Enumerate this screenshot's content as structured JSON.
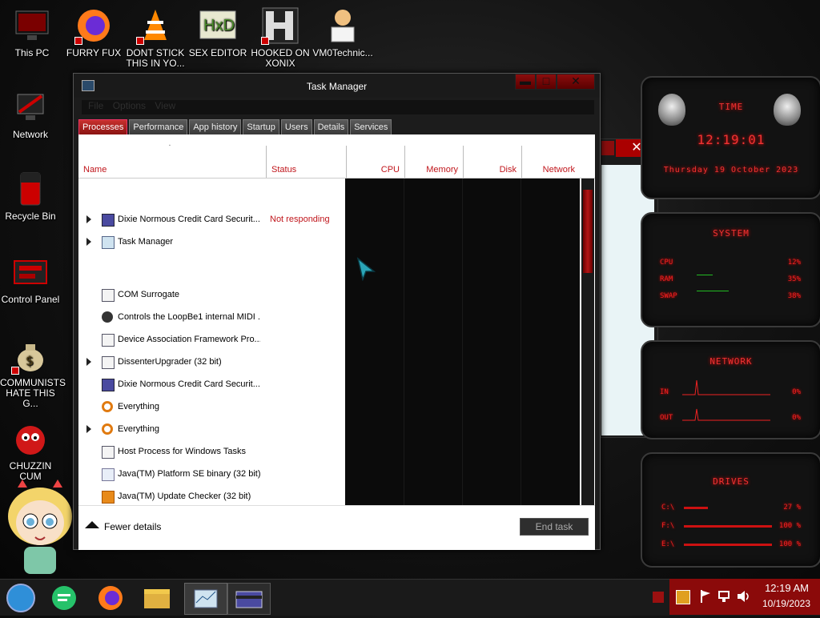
{
  "desktop_icons": [
    {
      "label": "This PC"
    },
    {
      "label": "FURRY FUX"
    },
    {
      "label": "DONT STICK THIS IN YO..."
    },
    {
      "label": "SEX EDITOR"
    },
    {
      "label": "HOOKED ON XONIX"
    },
    {
      "label": "VM0Technic..."
    },
    {
      "label": "Network"
    },
    {
      "label": "Recycle Bin"
    },
    {
      "label": "Control Panel"
    },
    {
      "label": "COMMUNISTS HATE THIS G..."
    },
    {
      "label": "CHUZZIN CUM"
    }
  ],
  "task_manager": {
    "title": "Task Manager",
    "menu": [
      "File",
      "Options",
      "View"
    ],
    "tabs": [
      "Processes",
      "Performance",
      "App history",
      "Startup",
      "Users",
      "Details",
      "Services"
    ],
    "active_tab": "Processes",
    "columns": {
      "name": "Name",
      "status": "Status",
      "cpu": "CPU",
      "memory": "Memory",
      "disk": "Disk",
      "network": "Network"
    },
    "rows": [
      {
        "name": "Dixie Normous Credit Card Securit...",
        "status": "Not responding",
        "expandable": true,
        "icon": "card-app-icon"
      },
      {
        "name": "Task Manager",
        "status": "",
        "expandable": true,
        "icon": "task-manager-icon"
      },
      {
        "name": "COM Surrogate",
        "status": "",
        "expandable": false,
        "icon": "window-icon"
      },
      {
        "name": "Controls the LoopBe1 internal MIDI ...",
        "status": "",
        "expandable": false,
        "icon": "midi-icon"
      },
      {
        "name": "Device Association Framework Pro...",
        "status": "",
        "expandable": false,
        "icon": "window-icon"
      },
      {
        "name": "DissenterUpgrader (32 bit)",
        "status": "",
        "expandable": true,
        "icon": "window-icon"
      },
      {
        "name": "Dixie Normous Credit Card Securit...",
        "status": "",
        "expandable": false,
        "icon": "card-app-icon"
      },
      {
        "name": "Everything",
        "status": "",
        "expandable": false,
        "icon": "magnifier-icon"
      },
      {
        "name": "Everything",
        "status": "",
        "expandable": true,
        "icon": "magnifier-icon"
      },
      {
        "name": "Host Process for Windows Tasks",
        "status": "",
        "expandable": false,
        "icon": "window-icon"
      },
      {
        "name": "Java(TM) Platform SE binary (32 bit)",
        "status": "",
        "expandable": false,
        "icon": "java-icon"
      },
      {
        "name": "Java(TM) Update Checker (32 bit)",
        "status": "",
        "expandable": false,
        "icon": "java-update-icon"
      }
    ],
    "fewer_details": "Fewer details",
    "end_task": "End task"
  },
  "widgets": {
    "time": {
      "title": "TIME",
      "clock": "12:19:01",
      "date": "Thursday 19 October 2023"
    },
    "system": {
      "title": "SYSTEM",
      "rows": [
        {
          "label": "CPU",
          "value": "12%"
        },
        {
          "label": "RAM",
          "value": "35%"
        },
        {
          "label": "SWAP",
          "value": "38%"
        }
      ]
    },
    "network": {
      "title": "NETWORK",
      "rows": [
        {
          "label": "IN",
          "value": "0%"
        },
        {
          "label": "OUT",
          "value": "0%"
        }
      ]
    },
    "drives": {
      "title": "DRIVES",
      "rows": [
        {
          "label": "C:\\",
          "value": "27 %"
        },
        {
          "label": "F:\\",
          "value": "100 %"
        },
        {
          "label": "E:\\",
          "value": "100 %"
        }
      ]
    }
  },
  "taskbar": {
    "time": "12:19 AM",
    "date": "10/19/2023"
  },
  "colors": {
    "accent_red": "#c0151b",
    "tray_red": "#8b0a0a"
  }
}
